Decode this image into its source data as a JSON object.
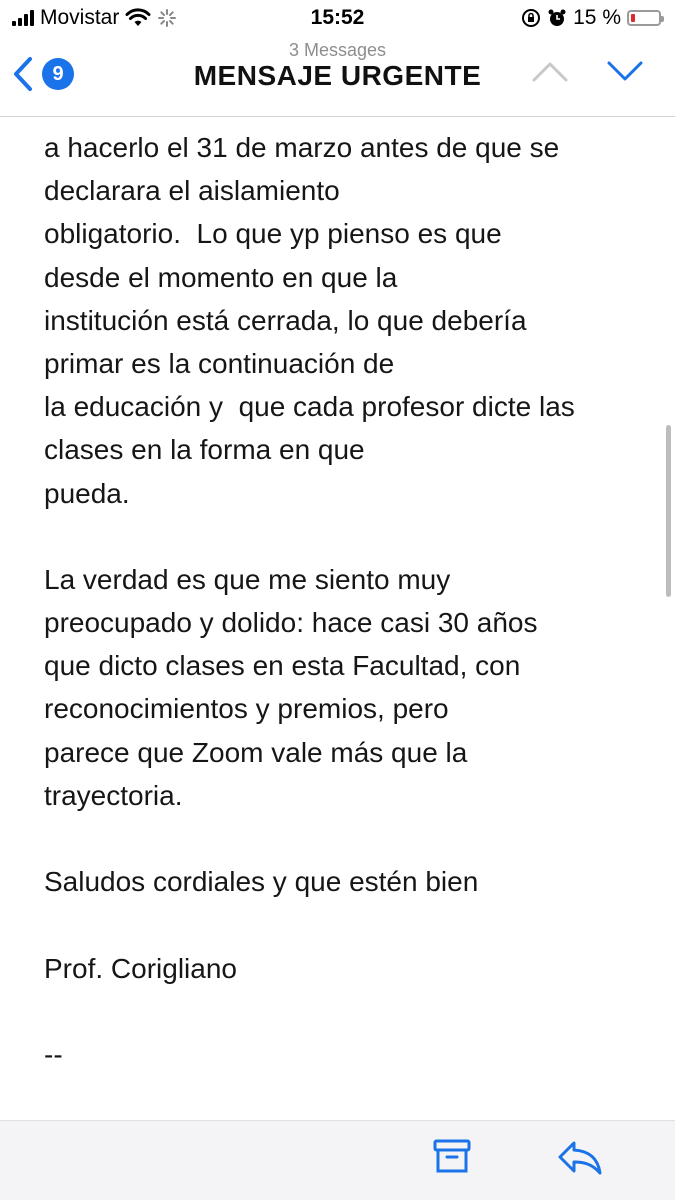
{
  "status_bar": {
    "carrier": "Movistar",
    "time": "15:52",
    "battery_percent": "15 %",
    "battery_level": 0.15
  },
  "header": {
    "message_count": "3 Messages",
    "title": "MENSAJE URGENTE",
    "unread_badge": "9"
  },
  "email": {
    "lines": [
      "a hacerlo el 31 de marzo antes de que se",
      "declarara el aislamiento",
      "obligatorio.  Lo que yp pienso es que",
      "desde el momento en que la",
      "institución está cerrada, lo que debería",
      "primar es la continuación de",
      "la educación y  que cada profesor dicte las",
      "clases en la forma en que",
      "pueda.",
      "",
      "La verdad es que me siento muy",
      "preocupado y dolido: hace casi 30 años",
      "que dicto clases en esta Facultad, con",
      "reconocimientos y premios, pero",
      "parece que Zoom vale más que la",
      "trayectoria.",
      "",
      "Saludos cordiales y que estén bien",
      "",
      "Prof. Corigliano",
      "",
      "--"
    ]
  },
  "colors": {
    "accent": "#1a73e8",
    "battery_low": "#e2262a",
    "toolbar_bg": "#f4f4f6"
  },
  "icons": {
    "back": "chevron-left-icon",
    "up": "chevron-up-icon",
    "down": "chevron-down-icon",
    "archive": "archive-icon",
    "reply": "reply-icon"
  }
}
